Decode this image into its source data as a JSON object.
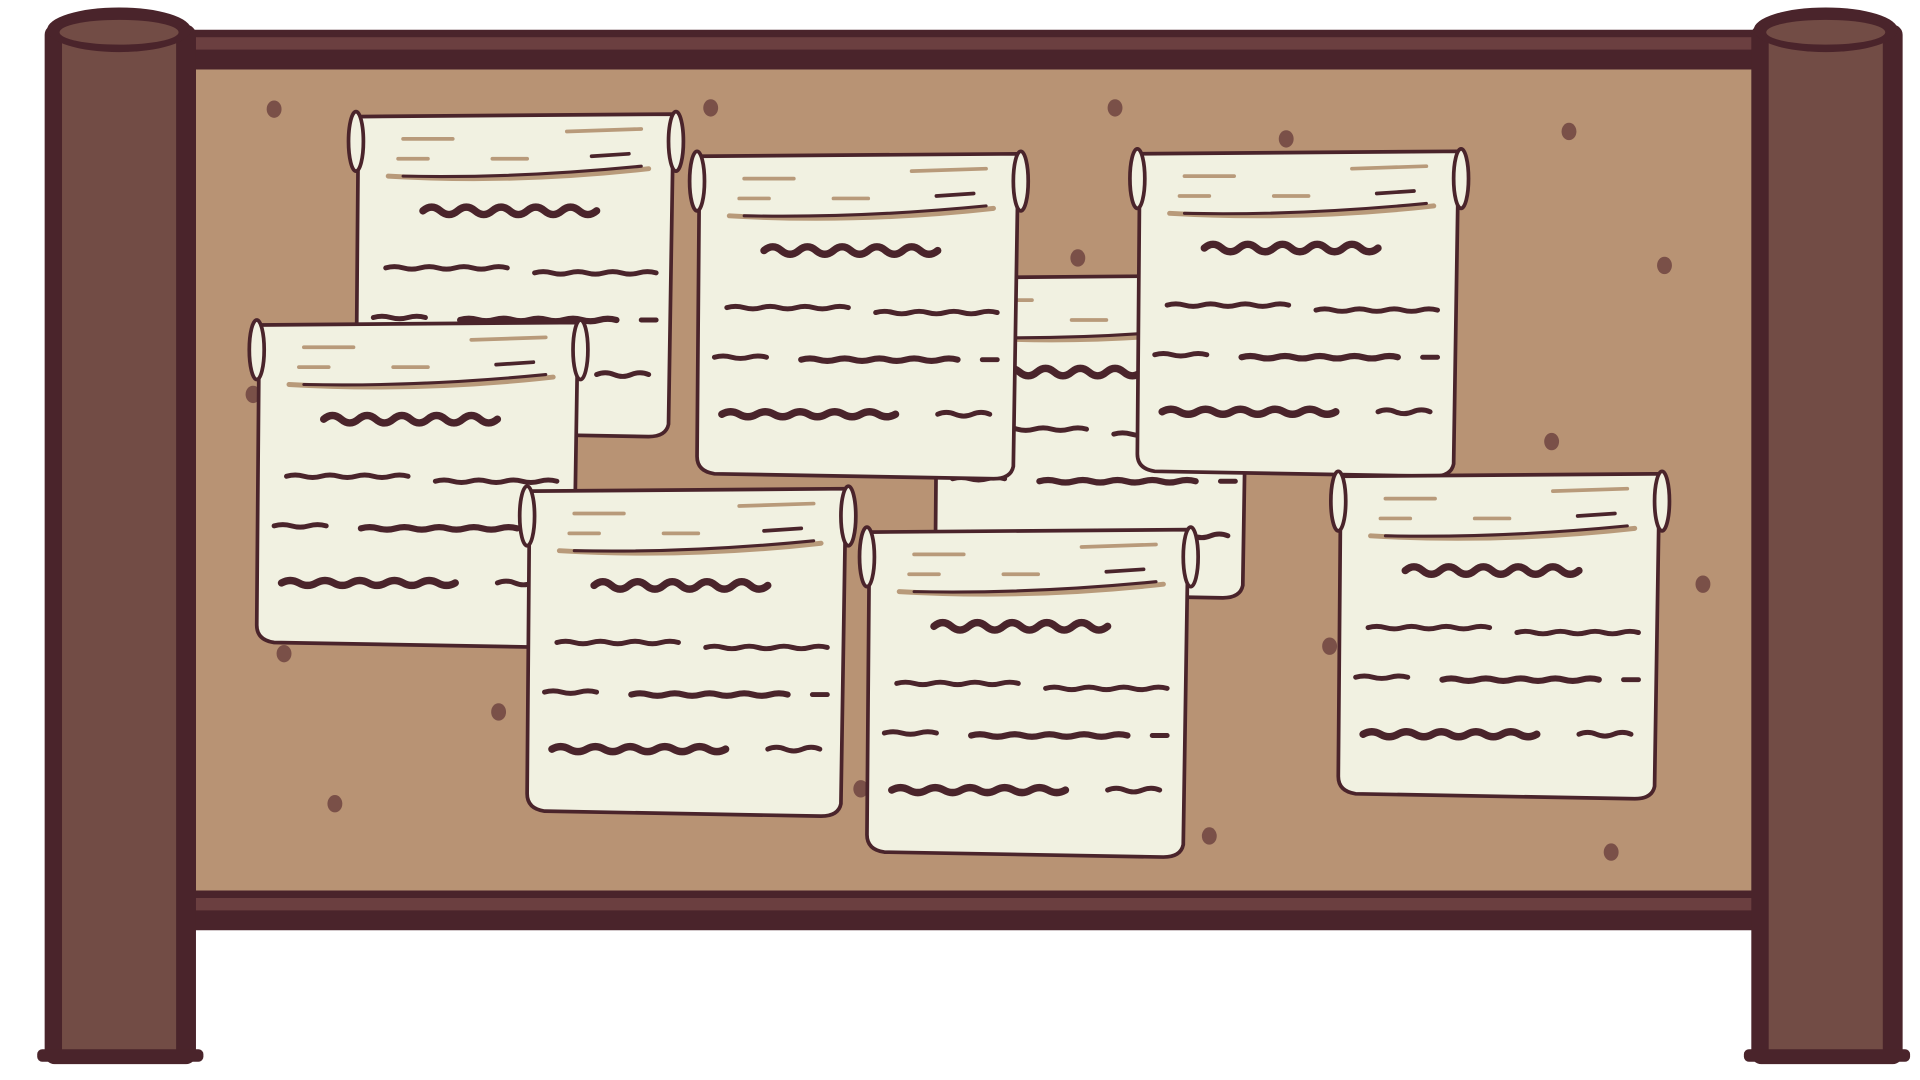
{
  "scene": {
    "subject": "quest-notice-board",
    "colors": {
      "background": "#ffffff",
      "outline": "#4a242b",
      "post": "#724c45",
      "board": "#b89374",
      "corkDot": "#7a5048",
      "paper": "#f1f1e1",
      "scribble": "#4a242b",
      "headerLine": "#b89a7a"
    }
  },
  "notices": [
    {
      "id": 1,
      "kind": "scroll"
    },
    {
      "id": 2,
      "kind": "scroll"
    },
    {
      "id": 3,
      "kind": "scroll"
    },
    {
      "id": 4,
      "kind": "scroll"
    },
    {
      "id": 5,
      "kind": "scroll"
    },
    {
      "id": 6,
      "kind": "scroll"
    },
    {
      "id": 7,
      "kind": "scroll"
    },
    {
      "id": 8,
      "kind": "scroll"
    }
  ]
}
